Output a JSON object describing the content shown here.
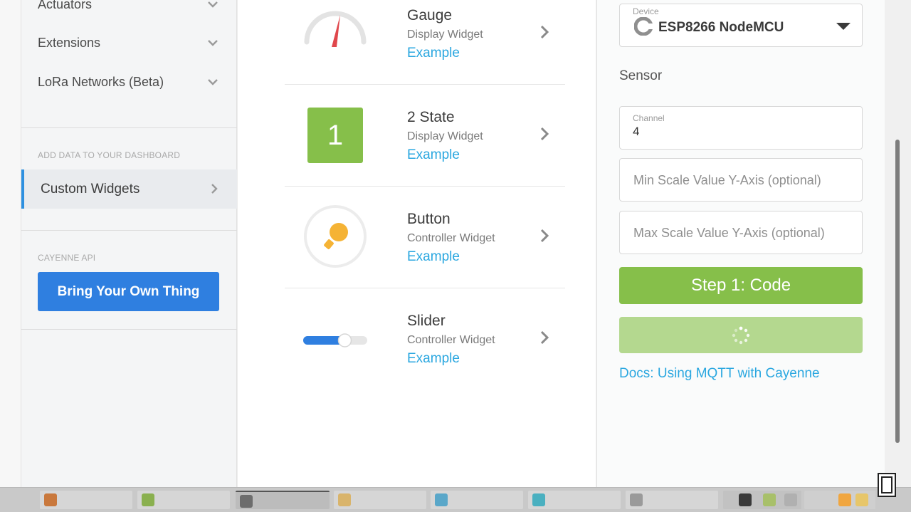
{
  "sidebar": {
    "items": [
      {
        "label": "Actuators"
      },
      {
        "label": "Extensions"
      },
      {
        "label": "LoRa Networks (Beta)"
      }
    ],
    "add_data_label": "ADD DATA TO YOUR DASHBOARD",
    "custom_widgets_label": "Custom Widgets",
    "api_label": "CAYENNE API",
    "byot_label": "Bring Your Own Thing"
  },
  "widgets": [
    {
      "title": "Gauge",
      "subtitle": "Display Widget",
      "link": "Example",
      "icon": "gauge-icon"
    },
    {
      "title": "2 State",
      "subtitle": "Display Widget",
      "link": "Example",
      "icon": "two-state-icon",
      "badge": "1"
    },
    {
      "title": "Button",
      "subtitle": "Controller Widget",
      "link": "Example",
      "icon": "lightbulb-icon"
    },
    {
      "title": "Slider",
      "subtitle": "Controller Widget",
      "link": "Example",
      "icon": "slider-icon",
      "level": 0.65
    }
  ],
  "form": {
    "device": {
      "label": "Device",
      "value": "ESP8266 NodeMCU"
    },
    "sensor_label": "Sensor",
    "channel": {
      "label": "Channel",
      "value": "4"
    },
    "min_placeholder": "Min Scale Value Y-Axis (optional)",
    "max_placeholder": "Max Scale Value Y-Axis (optional)",
    "step_label": "Step 1: Code",
    "docs_link": "Docs: Using MQTT with Cayenne"
  },
  "colors": {
    "accent_blue": "#2f7fe0",
    "link": "#2aa7e0",
    "green": "#86bf4a",
    "green_light": "#b4d88f",
    "gauge_needle": "#e0474c",
    "bulb": "#f5b335"
  }
}
